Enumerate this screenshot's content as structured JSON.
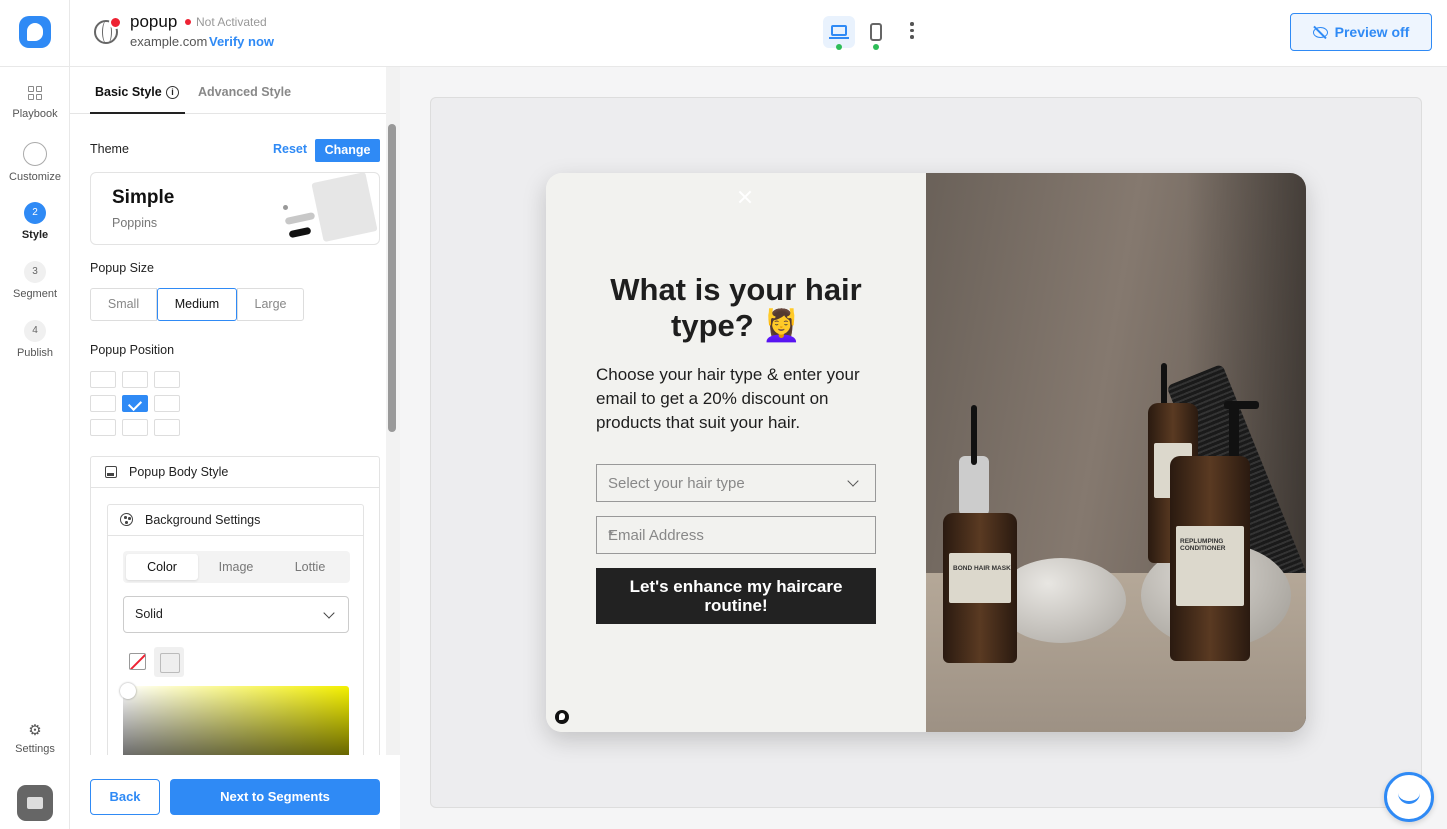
{
  "rail": {
    "items": [
      {
        "label": "Playbook"
      },
      {
        "label": "Customize"
      },
      {
        "label": "Style",
        "num": "2"
      },
      {
        "label": "Segment",
        "num": "3"
      },
      {
        "label": "Publish",
        "num": "4"
      }
    ],
    "settings_label": "Settings"
  },
  "header": {
    "site_name": "popup",
    "status": "Not Activated",
    "domain": "example.com",
    "verify_link": "Verify now",
    "preview_button": "Preview off"
  },
  "panel": {
    "tabs": [
      {
        "label": "Basic Style"
      },
      {
        "label": "Advanced Style"
      }
    ],
    "theme": {
      "label": "Theme",
      "reset": "Reset",
      "change": "Change",
      "name": "Simple",
      "font": "Poppins"
    },
    "popup_size": {
      "label": "Popup Size",
      "options": [
        "Small",
        "Medium",
        "Large"
      ],
      "selected": "Medium"
    },
    "popup_position": {
      "label": "Popup Position",
      "selected": "middle-center"
    },
    "body_style": {
      "title": "Popup Body Style",
      "background": {
        "title": "Background Settings",
        "tabs": [
          "Color",
          "Image",
          "Lottie"
        ],
        "selected_tab": "Color",
        "fill_type": "Solid"
      }
    },
    "back_button": "Back",
    "next_button": "Next to Segments"
  },
  "popup": {
    "title": "What is your hair type? 💆‍♀️",
    "description": "Choose your hair type & enter your email to get a 20% discount on products that suit your hair.",
    "select_placeholder": "Select your hair type",
    "email_placeholder": "Email Address",
    "required_mark": "*",
    "cta": "Let's enhance my haircare routine!",
    "bottle_labels": [
      "BOND HAIR MASK",
      "REPLUMPING CONDITIONER"
    ]
  },
  "colors": {
    "accent": "#2f8af5",
    "status_red": "#e22233",
    "online_green": "#2ebd58",
    "popup_bg": "#f2f2ef",
    "cta_bg": "#222222"
  }
}
